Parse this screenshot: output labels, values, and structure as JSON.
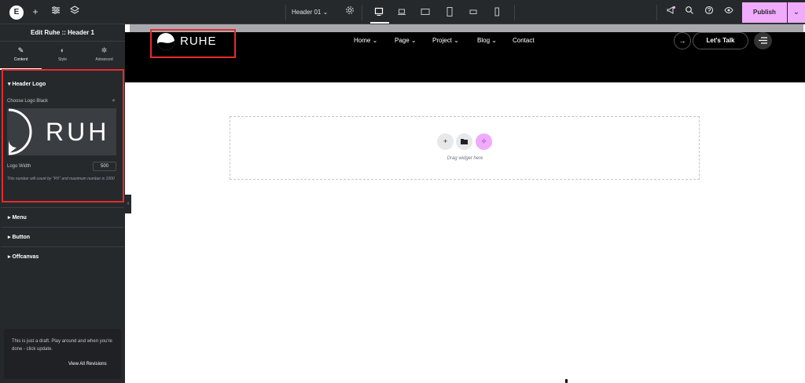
{
  "topbar": {
    "document_title": "Header 01 ⌄",
    "publish_label": "Publish"
  },
  "panel": {
    "title": "Edit Ruhe :: Header 1",
    "tabs": [
      {
        "label": "Content",
        "icon": "pencil-icon"
      },
      {
        "label": "Style",
        "icon": "contrast-icon"
      },
      {
        "label": "Advanced",
        "icon": "gear-icon"
      }
    ],
    "header_logo": {
      "title": "Header Logo",
      "choose_label": "Choose Logo Black",
      "logo_preview_text": "RUH",
      "width_label": "Logo Width",
      "width_value": "500",
      "help_text": "This number will count by \"PX\" and maximum number is 1000"
    },
    "sections": [
      "Menu",
      "Button",
      "Offcanvas"
    ],
    "draft": {
      "text": "This is just a draft. Play around and when you're done - click update.",
      "link": "View All Revisions"
    }
  },
  "site": {
    "brand": "RUHE",
    "nav": [
      "Home ⌄",
      "Page ⌄",
      "Project ⌄",
      "Blog ⌄",
      "Contact"
    ],
    "cta": "Let's Talk"
  },
  "dropzone": {
    "text": "Drag widget here"
  },
  "colors": {
    "editor_bg": "#26292c",
    "publish_accent": "#f0abfc",
    "highlight": "#e52b2b"
  }
}
